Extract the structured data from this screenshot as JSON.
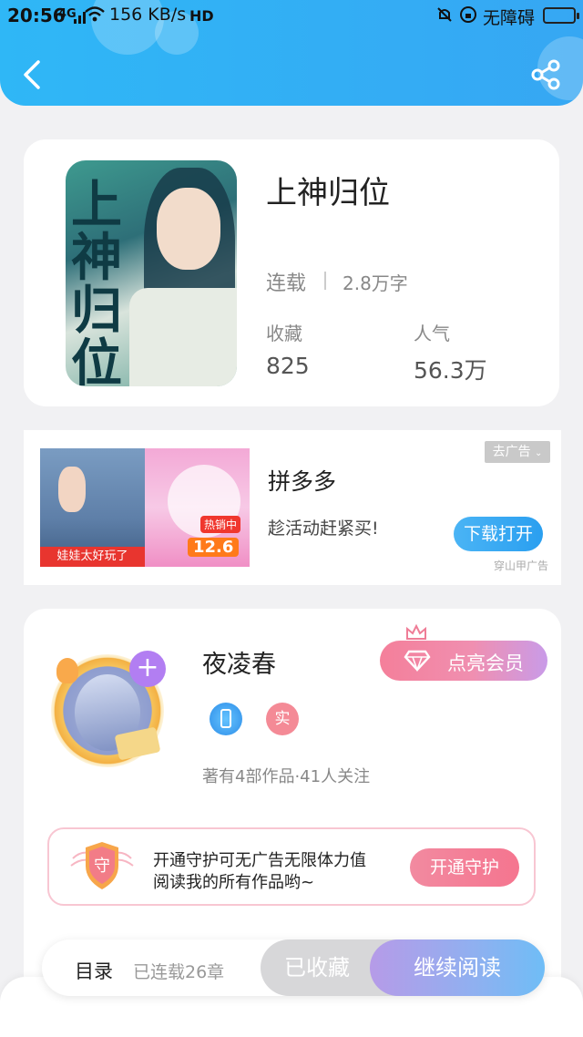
{
  "status_bar": {
    "time": "20:56",
    "network_type": "4G",
    "speed": "156 KB/s",
    "hd": "HD",
    "accessibility": "无障碍"
  },
  "book": {
    "title": "上神归位",
    "status": "连载",
    "word_count": "2.8万字",
    "favorites_label": "收藏",
    "favorites": "825",
    "popularity_label": "人气",
    "popularity": "56.3万",
    "cover_text": "上神归位"
  },
  "ad": {
    "close_label": "去广告",
    "app_name": "拼多多",
    "slogan": "趁活动赶紧买!",
    "button_label": "下载打开",
    "source": "穿山甲广告",
    "img_caption_left": "娃娃太好玩了",
    "img_tag": "热销中",
    "img_price": "12.6"
  },
  "author": {
    "name": "夜凌春",
    "vip_button": "点亮会员",
    "badge_verified": "实",
    "stats": "著有4部作品·41人关注"
  },
  "guard": {
    "badge": "守",
    "line1": "开通守护可无广告无限体力值",
    "line2": "阅读我的所有作品哟~",
    "button": "开通守护"
  },
  "bottom": {
    "catalog": "目录",
    "chapters": "已连载26章",
    "collected": "已收藏",
    "read": "继续阅读"
  },
  "colors": {
    "header": "#2fb7f6",
    "accent_pink": "#f28aa0",
    "accent_purple": "#b27ef2"
  }
}
